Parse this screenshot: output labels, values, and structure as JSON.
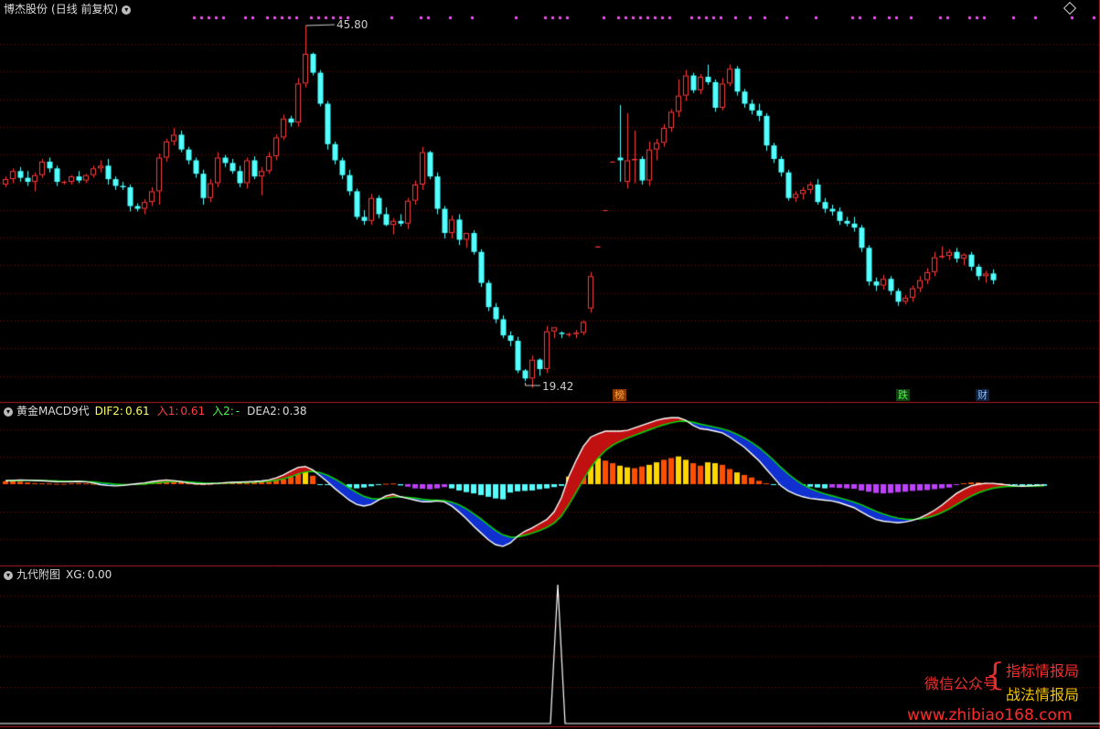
{
  "price_panel": {
    "stock_name": "博杰股份",
    "period": "(日线 前复权)",
    "high_marker": "45.80",
    "low_marker": "19.42",
    "tags": [
      "榜",
      "跌",
      "财"
    ]
  },
  "macd_panel": {
    "name": "黄金MACD9代",
    "dif2_label": "DIF2:",
    "dif2_value": "0.61",
    "ru1_label": "入1:",
    "ru1_value": "0.61",
    "ru2_label": "入2:",
    "ru2_value": "-",
    "dea2_label": "DEA2:",
    "dea2_value": "0.38"
  },
  "signal_panel": {
    "name": "九代附图",
    "xg_label": "XG:",
    "xg_value": "0.00"
  },
  "watermark": {
    "key": "微信公众号",
    "line1": "指标情报局",
    "line2": "战法情报局",
    "url": "www.zhibiao168.com"
  },
  "colors": {
    "up": "#ff3c3c",
    "down": "#54ffff",
    "grid": "#7a1010",
    "border": "#b01c1c",
    "dif": "#ffffff",
    "dea": "#00e000",
    "magenta": "#ff44ff"
  },
  "chart_data": {
    "type": "candlestick",
    "price_range": [
      19.42,
      45.8
    ],
    "candles": [
      [
        34.0,
        34.6,
        33.8,
        34.4
      ],
      [
        34.4,
        35.2,
        34.1,
        35.0
      ],
      [
        35.0,
        35.3,
        34.2,
        34.5
      ],
      [
        34.5,
        35.0,
        33.9,
        34.2
      ],
      [
        34.2,
        34.9,
        33.5,
        34.7
      ],
      [
        34.7,
        35.9,
        34.5,
        35.7
      ],
      [
        35.7,
        36.0,
        34.9,
        35.2
      ],
      [
        35.2,
        35.4,
        33.9,
        34.2
      ],
      [
        34.2,
        34.3,
        34.0,
        34.2
      ],
      [
        34.2,
        34.7,
        34.0,
        34.6
      ],
      [
        34.6,
        35.0,
        34.1,
        34.3
      ],
      [
        34.3,
        34.8,
        34.1,
        34.7
      ],
      [
        34.7,
        35.4,
        34.5,
        35.2
      ],
      [
        35.2,
        35.8,
        34.9,
        35.4
      ],
      [
        35.4,
        35.9,
        34.0,
        34.4
      ],
      [
        34.4,
        34.6,
        33.6,
        33.9
      ],
      [
        33.9,
        34.2,
        33.6,
        33.8
      ],
      [
        33.8,
        34.0,
        32.0,
        32.4
      ],
      [
        32.4,
        32.6,
        32.0,
        32.2
      ],
      [
        32.2,
        32.9,
        31.8,
        32.7
      ],
      [
        32.7,
        33.8,
        32.4,
        33.5
      ],
      [
        33.5,
        36.3,
        32.5,
        36.0
      ],
      [
        36.0,
        37.4,
        35.7,
        37.2
      ],
      [
        37.2,
        38.2,
        36.9,
        37.7
      ],
      [
        37.7,
        38.0,
        36.4,
        36.6
      ],
      [
        36.6,
        36.8,
        35.5,
        35.8
      ],
      [
        35.8,
        36.0,
        34.5,
        34.8
      ],
      [
        34.8,
        35.1,
        32.5,
        33.0
      ],
      [
        33.0,
        34.4,
        32.7,
        34.1
      ],
      [
        34.1,
        36.4,
        33.8,
        36.0
      ],
      [
        36.0,
        36.2,
        35.3,
        35.6
      ],
      [
        35.6,
        35.9,
        34.8,
        35.0
      ],
      [
        35.0,
        35.4,
        33.8,
        34.1
      ],
      [
        34.1,
        36.0,
        33.7,
        35.8
      ],
      [
        35.8,
        36.1,
        34.4,
        34.6
      ],
      [
        34.6,
        35.3,
        33.2,
        35.0
      ],
      [
        35.0,
        36.4,
        34.8,
        36.1
      ],
      [
        36.1,
        37.7,
        35.8,
        37.5
      ],
      [
        37.5,
        39.2,
        37.3,
        38.9
      ],
      [
        38.9,
        39.1,
        38.3,
        38.6
      ],
      [
        38.6,
        41.9,
        38.3,
        41.5
      ],
      [
        41.5,
        45.8,
        41.2,
        43.7
      ],
      [
        43.7,
        43.8,
        42.1,
        42.3
      ],
      [
        42.3,
        42.5,
        39.8,
        40.0
      ],
      [
        40.0,
        40.2,
        36.6,
        37.0
      ],
      [
        37.0,
        37.2,
        35.5,
        35.8
      ],
      [
        35.8,
        36.0,
        34.4,
        34.7
      ],
      [
        34.7,
        35.1,
        33.2,
        33.5
      ],
      [
        33.5,
        33.7,
        31.4,
        31.6
      ],
      [
        31.6,
        32.1,
        31.0,
        31.3
      ],
      [
        31.3,
        33.3,
        31.0,
        33.0
      ],
      [
        33.0,
        33.2,
        31.5,
        31.8
      ],
      [
        31.8,
        32.3,
        30.9,
        31.0
      ],
      [
        31.0,
        31.5,
        30.3,
        31.3
      ],
      [
        31.3,
        31.8,
        30.9,
        31.1
      ],
      [
        31.1,
        33.0,
        30.7,
        32.8
      ],
      [
        32.8,
        34.3,
        32.5,
        34.0
      ],
      [
        34.0,
        36.8,
        33.6,
        36.4
      ],
      [
        36.4,
        36.5,
        34.4,
        34.6
      ],
      [
        34.6,
        34.9,
        31.8,
        32.2
      ],
      [
        32.2,
        32.4,
        30.0,
        30.4
      ],
      [
        30.4,
        31.7,
        30.0,
        31.4
      ],
      [
        31.4,
        31.8,
        29.5,
        29.9
      ],
      [
        29.9,
        30.2,
        29.3,
        30.4
      ],
      [
        30.4,
        30.6,
        28.8,
        29.0
      ],
      [
        29.0,
        29.2,
        26.4,
        26.7
      ],
      [
        26.7,
        26.9,
        24.6,
        24.9
      ],
      [
        24.9,
        25.2,
        23.7,
        24.0
      ],
      [
        24.0,
        24.3,
        22.6,
        22.8
      ],
      [
        22.8,
        23.1,
        22.0,
        22.4
      ],
      [
        22.4,
        22.7,
        20.0,
        20.2
      ],
      [
        20.2,
        20.3,
        19.4,
        19.6
      ],
      [
        19.6,
        21.3,
        18.9,
        21.0
      ],
      [
        21.0,
        21.1,
        19.8,
        20.3
      ],
      [
        20.3,
        23.5,
        20.0,
        23.1
      ],
      [
        23.1,
        23.3,
        22.6,
        23.4
      ],
      [
        23.0,
        23.1,
        22.6,
        22.9
      ],
      [
        22.9,
        23.0,
        22.7,
        22.9
      ],
      [
        22.9,
        23.2,
        22.6,
        23.0
      ],
      [
        23.0,
        23.9,
        22.8,
        23.8
      ],
      [
        24.8,
        27.5,
        24.5,
        27.2
      ],
      [
        29.4,
        29.4,
        29.4,
        29.4
      ],
      [
        32.1,
        32.1,
        32.1,
        32.1
      ],
      [
        35.7,
        35.7,
        35.7,
        35.7
      ],
      [
        36.0,
        39.9,
        34.2,
        35.8
      ],
      [
        34.2,
        39.3,
        33.7,
        35.8
      ],
      [
        35.8,
        38.0,
        34.1,
        35.9
      ],
      [
        35.9,
        36.1,
        34.0,
        34.3
      ],
      [
        34.3,
        37.2,
        33.9,
        36.6
      ],
      [
        36.6,
        37.4,
        35.8,
        37.1
      ],
      [
        37.1,
        38.5,
        36.8,
        38.2
      ],
      [
        38.2,
        39.6,
        37.9,
        39.4
      ],
      [
        39.4,
        41.8,
        39.0,
        40.6
      ],
      [
        40.6,
        42.5,
        40.2,
        42.1
      ],
      [
        42.1,
        42.3,
        40.8,
        41.0
      ],
      [
        41.0,
        42.2,
        40.7,
        42.0
      ],
      [
        42.0,
        42.9,
        41.4,
        41.6
      ],
      [
        41.6,
        41.8,
        39.4,
        39.7
      ],
      [
        39.7,
        41.9,
        39.5,
        41.5
      ],
      [
        41.5,
        42.9,
        41.3,
        42.6
      ],
      [
        42.6,
        42.8,
        40.6,
        40.9
      ],
      [
        40.9,
        41.1,
        39.7,
        40.0
      ],
      [
        40.0,
        40.3,
        39.2,
        39.5
      ],
      [
        39.5,
        40.0,
        38.7,
        39.1
      ],
      [
        39.1,
        39.3,
        36.5,
        36.9
      ],
      [
        36.9,
        37.1,
        35.6,
        35.9
      ],
      [
        35.9,
        36.1,
        34.6,
        34.9
      ],
      [
        34.9,
        35.1,
        32.8,
        33.0
      ],
      [
        33.0,
        33.5,
        32.7,
        33.3
      ],
      [
        33.3,
        33.8,
        32.9,
        33.6
      ],
      [
        33.6,
        34.2,
        33.3,
        34.0
      ],
      [
        34.0,
        34.4,
        32.5,
        32.7
      ],
      [
        32.7,
        33.0,
        31.9,
        32.2
      ],
      [
        32.2,
        32.5,
        31.7,
        32.0
      ],
      [
        32.0,
        32.3,
        31.0,
        31.3
      ],
      [
        31.3,
        31.6,
        30.9,
        31.1
      ],
      [
        31.1,
        31.6,
        30.5,
        30.8
      ],
      [
        30.8,
        31.0,
        29.0,
        29.3
      ],
      [
        29.3,
        29.5,
        26.5,
        26.8
      ],
      [
        26.8,
        27.1,
        26.1,
        26.5
      ],
      [
        26.5,
        27.3,
        26.2,
        27.0
      ],
      [
        27.0,
        27.2,
        25.8,
        26.1
      ],
      [
        26.1,
        26.3,
        25.0,
        25.3
      ],
      [
        25.3,
        25.8,
        25.1,
        25.6
      ],
      [
        25.6,
        26.5,
        25.3,
        26.3
      ],
      [
        26.3,
        27.2,
        26.0,
        26.9
      ],
      [
        26.9,
        27.8,
        26.6,
        27.5
      ],
      [
        27.5,
        29.0,
        27.2,
        28.6
      ],
      [
        28.6,
        29.4,
        28.5,
        28.7
      ],
      [
        28.7,
        29.2,
        28.4,
        29.0
      ],
      [
        29.0,
        29.3,
        28.2,
        28.5
      ],
      [
        28.5,
        28.9,
        28.0,
        28.8
      ],
      [
        28.8,
        29.0,
        27.6,
        27.9
      ],
      [
        27.9,
        28.1,
        26.9,
        27.2
      ],
      [
        27.2,
        27.6,
        26.7,
        27.4
      ],
      [
        27.4,
        27.7,
        26.6,
        26.9
      ]
    ],
    "ru_markers": [
      24,
      25,
      26,
      27,
      28,
      31,
      32,
      34,
      35,
      36,
      37,
      38,
      40,
      41,
      42,
      43,
      44,
      45,
      51,
      55,
      56,
      59,
      62,
      68,
      72,
      73,
      74,
      75,
      80,
      82,
      83,
      84,
      85,
      86,
      87,
      88,
      89,
      92,
      93,
      94,
      95,
      96,
      98,
      100,
      102,
      105,
      109,
      114,
      115,
      117,
      119,
      120,
      122,
      126,
      127,
      130,
      131,
      132,
      136,
      139,
      144,
      147
    ],
    "macd": {
      "hist": [
        0.35,
        0.4,
        0.3,
        0.2,
        0.12,
        0.1,
        0.08,
        0.05,
        0.05,
        0.1,
        0.12,
        0.1,
        0.05,
        -0.1,
        -0.15,
        -0.1,
        -0.05,
        0.0,
        0.03,
        0.05,
        0.15,
        0.2,
        0.3,
        0.28,
        0.2,
        0.1,
        0.05,
        0.02,
        0.05,
        0.1,
        0.15,
        0.18,
        0.2,
        0.22,
        0.25,
        0.28,
        0.3,
        0.45,
        0.6,
        0.9,
        1.4,
        1.6,
        1.0,
        -0.05,
        -0.1,
        -0.2,
        -0.3,
        -0.4,
        -0.5,
        -0.4,
        -0.25,
        -0.1,
        0.05,
        0.08,
        -0.15,
        -0.3,
        -0.5,
        -0.55,
        -0.6,
        -0.5,
        -0.35,
        -0.5,
        -0.75,
        -0.95,
        -1.1,
        -1.3,
        -1.5,
        -1.7,
        -1.8,
        -1.0,
        -0.85,
        -0.8,
        -0.75,
        -0.6,
        -0.5,
        -0.35,
        -0.2,
        0.9,
        1.8,
        2.7,
        3.2,
        3.1,
        2.8,
        2.5,
        2.2,
        2.0,
        1.9,
        2.1,
        2.3,
        2.6,
        2.9,
        3.1,
        3.3,
        2.9,
        2.5,
        2.2,
        2.6,
        2.5,
        2.3,
        1.8,
        1.4,
        1.1,
        0.8,
        0.4,
        0.1,
        -0.05,
        -0.1,
        -0.3,
        -0.5,
        -0.4,
        -0.3,
        -0.4,
        -0.5,
        -0.4,
        -0.45,
        -0.5,
        -0.55,
        -0.75,
        -0.9,
        -1.05,
        -1.1,
        -1.05,
        -0.95,
        -0.9,
        -0.8,
        -0.75,
        -0.7,
        -0.6,
        -0.5,
        -0.4,
        -0.1,
        0.1,
        0.2,
        0.2,
        0.15,
        0.12,
        0.1,
        -0.1,
        -0.15,
        -0.2,
        -0.18,
        -0.15,
        -0.2
      ],
      "dif": [
        0.4,
        0.45,
        0.5,
        0.48,
        0.44,
        0.4,
        0.35,
        0.3,
        0.28,
        0.3,
        0.32,
        0.28,
        0.15,
        -0.05,
        -0.15,
        -0.2,
        -0.15,
        -0.05,
        0.05,
        0.15,
        0.3,
        0.4,
        0.5,
        0.42,
        0.3,
        0.15,
        0.05,
        0.02,
        0.05,
        0.1,
        0.18,
        0.22,
        0.25,
        0.28,
        0.32,
        0.38,
        0.5,
        0.75,
        1.1,
        1.55,
        2.0,
        2.1,
        1.7,
        1.0,
        0.3,
        -0.5,
        -1.2,
        -1.9,
        -2.4,
        -2.6,
        -2.4,
        -1.9,
        -1.4,
        -1.2,
        -1.5,
        -1.7,
        -1.9,
        -2.1,
        -2.1,
        -2.0,
        -2.1,
        -2.6,
        -3.3,
        -4.1,
        -5.0,
        -5.8,
        -6.6,
        -7.2,
        -7.4,
        -7.0,
        -6.2,
        -5.6,
        -5.2,
        -4.7,
        -4.2,
        -3.3,
        -1.6,
        0.9,
        2.8,
        4.5,
        5.6,
        6.0,
        6.3,
        6.3,
        6.3,
        6.4,
        6.7,
        7.0,
        7.3,
        7.6,
        7.8,
        7.9,
        7.9,
        7.6,
        7.0,
        6.6,
        6.5,
        6.3,
        6.1,
        5.6,
        5.0,
        4.4,
        3.6,
        2.8,
        1.8,
        0.8,
        -0.2,
        -0.8,
        -1.2,
        -1.5,
        -1.7,
        -1.8,
        -1.9,
        -2.0,
        -2.2,
        -2.5,
        -2.8,
        -3.3,
        -3.8,
        -4.2,
        -4.4,
        -4.5,
        -4.6,
        -4.5,
        -4.3,
        -4.0,
        -3.6,
        -3.1,
        -2.5,
        -1.8,
        -1.1,
        -0.6,
        -0.2,
        0.0,
        0.1,
        0.1,
        0.0,
        -0.1,
        -0.2,
        -0.25,
        -0.2,
        -0.15,
        -0.1
      ]
    }
  }
}
